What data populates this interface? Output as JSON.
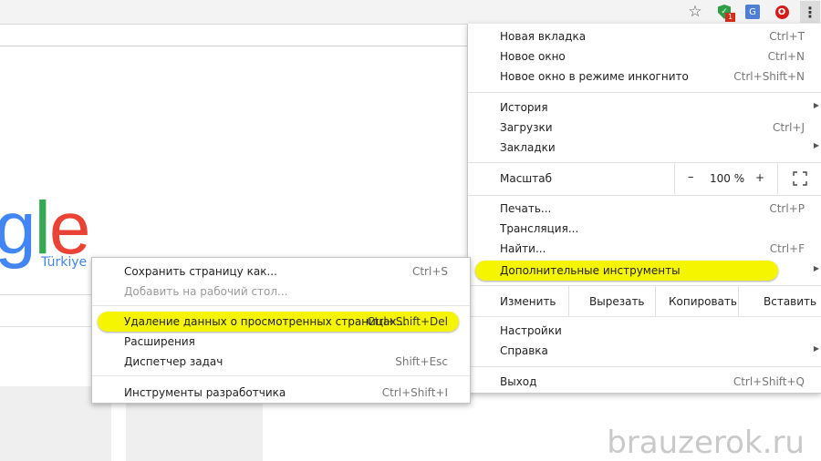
{
  "toolbar": {
    "icons": [
      "star-icon",
      "shield-extension-icon",
      "translate-extension-icon",
      "opera-extension-icon",
      "more-menu-icon"
    ],
    "shield_badge": "1"
  },
  "page": {
    "logo_letters": [
      "g",
      "l",
      "e"
    ],
    "logo_subtitle": "Türkiye",
    "watermark": "brauzerok.ru",
    "colors": {
      "blue": "#4285f4",
      "green": "#34a853",
      "red": "#ea4335",
      "highlight": "#f5f500"
    }
  },
  "main_menu": {
    "new_tab": {
      "label": "Новая вкладка",
      "shortcut": "Ctrl+T"
    },
    "new_window": {
      "label": "Новое окно",
      "shortcut": "Ctrl+N"
    },
    "incognito": {
      "label": "Новое окно в режиме инкогнито",
      "shortcut": "Ctrl+Shift+N"
    },
    "history": {
      "label": "История"
    },
    "downloads": {
      "label": "Загрузки",
      "shortcut": "Ctrl+J"
    },
    "bookmarks": {
      "label": "Закладки"
    },
    "zoom": {
      "label": "Масштаб",
      "minus": "–",
      "value": "100 %",
      "plus": "+"
    },
    "print": {
      "label": "Печать...",
      "shortcut": "Ctrl+P"
    },
    "cast": {
      "label": "Трансляция..."
    },
    "find": {
      "label": "Найти...",
      "shortcut": "Ctrl+F"
    },
    "more_tools": {
      "label": "Дополнительные инструменты"
    },
    "edit": {
      "label": "Изменить",
      "cut": "Вырезать",
      "copy": "Копировать",
      "paste": "Вставить"
    },
    "settings": {
      "label": "Настройки"
    },
    "help": {
      "label": "Справка"
    },
    "exit": {
      "label": "Выход",
      "shortcut": "Ctrl+Shift+Q"
    }
  },
  "sub_menu": {
    "save_page": {
      "label": "Сохранить страницу как...",
      "shortcut": "Ctrl+S"
    },
    "add_to_desktop": {
      "label": "Добавить на рабочий стол..."
    },
    "clear_data": {
      "label": "Удаление данных о просмотренных страницах...",
      "shortcut": "Ctrl+Shift+Del"
    },
    "extensions": {
      "label": "Расширения"
    },
    "task_manager": {
      "label": "Диспетчер задач",
      "shortcut": "Shift+Esc"
    },
    "dev_tools": {
      "label": "Инструменты разработчика",
      "shortcut": "Ctrl+Shift+I"
    }
  }
}
